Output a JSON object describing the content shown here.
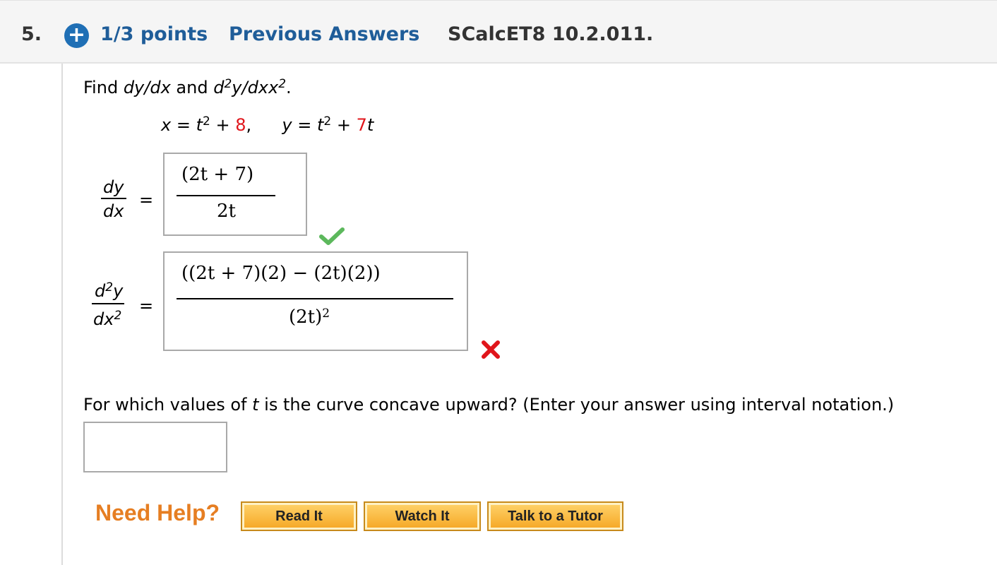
{
  "header": {
    "question_number": "5.",
    "points": "1/3 points",
    "previous_answers": "Previous Answers",
    "problem_code": "SCalcET8 10.2.011."
  },
  "prompt": {
    "find": "Find",
    "dydx": "dy/dx",
    "and": "and",
    "d2": "d",
    "exp2": "2",
    "y_over": "y/dx",
    "period": "."
  },
  "equations": {
    "x_lhs": "x = t",
    "x_plus": " + ",
    "x_const": "8",
    "comma": ",",
    "y_lhs": "y = t",
    "y_plus": " + ",
    "y_coef": "7",
    "t": "t"
  },
  "answer1": {
    "lhs_num": "dy",
    "lhs_den": "dx",
    "equals": "=",
    "numerator": "(2t + 7)",
    "denominator": "2t",
    "status": "correct"
  },
  "answer2": {
    "lhs_num": "d",
    "lhs_num_rest": "y",
    "lhs_den": "dx",
    "exp": "2",
    "equals": "=",
    "numerator": "((2t + 7)(2) − (2t)(2))",
    "denominator": "(2t)",
    "den_exp": "2",
    "status": "incorrect"
  },
  "question3": {
    "text_before": "For which values of ",
    "var": "t",
    "text_after": " is the curve concave upward? (Enter your answer using interval notation.)",
    "value": ""
  },
  "help": {
    "label": "Need Help?",
    "read_it": "Read It",
    "watch_it": "Watch It",
    "talk_tutor": "Talk to a Tutor"
  },
  "colors": {
    "accent_blue": "#1f5d99",
    "correct_green": "#5cb85c",
    "incorrect_red": "#e0151b",
    "help_orange": "#e67e22"
  }
}
